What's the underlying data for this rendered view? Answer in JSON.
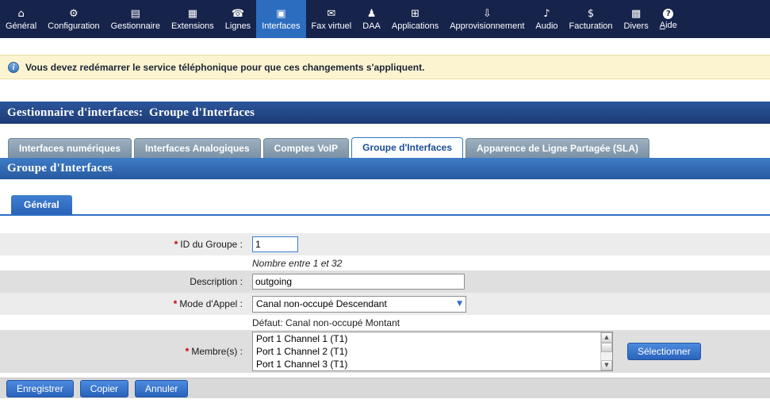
{
  "colors": {
    "accent": "#2d6fc4",
    "nav_bg": "#16234b",
    "nav_active_bg": "#2d6dbf",
    "banner_bg": "#fcf4d1",
    "header_bg": "#24498c",
    "required": "#cc0000"
  },
  "icons": {
    "general": "⌂",
    "configuration": "⚙",
    "gestionnaire": "▤",
    "extensions": "▦",
    "lignes": "☎",
    "interfaces": "▣",
    "fax": "✉",
    "daa": "♟",
    "applications": "⊞",
    "approvisionnement": "⇩",
    "audio": "♪",
    "facturation": "$",
    "divers": "▩",
    "aide": "?",
    "info": "i",
    "dropdown_arrow": "▼",
    "scroll_up": "▲",
    "scroll_down": "▼"
  },
  "nav": {
    "items": [
      {
        "label": "Général"
      },
      {
        "label": "Configuration"
      },
      {
        "label": "Gestionnaire"
      },
      {
        "label": "Extensions"
      },
      {
        "label": "Lignes"
      },
      {
        "label": "Interfaces"
      },
      {
        "label": "Fax virtuel"
      },
      {
        "label": "DAA"
      },
      {
        "label": "Applications"
      },
      {
        "label": "Approvisionnement"
      },
      {
        "label": "Audio"
      },
      {
        "label": "Facturation"
      },
      {
        "label": "Divers"
      },
      {
        "label": "Aide"
      }
    ]
  },
  "banner": {
    "text": "Vous devez redémarrer le service téléphonique pour que ces changements s'appliquent."
  },
  "page_header": {
    "title": "Gestionnaire d'interfaces:  Groupe d'Interfaces"
  },
  "tabs": [
    {
      "label": "Interfaces numériques"
    },
    {
      "label": "Interfaces Analogiques"
    },
    {
      "label": "Comptes VoIP"
    },
    {
      "label": "Groupe d'Interfaces"
    },
    {
      "label": "Apparence de Ligne Partagée (SLA)"
    }
  ],
  "section_header": {
    "title": "Groupe d'Interfaces"
  },
  "subtabs": [
    {
      "label": "Général"
    }
  ],
  "form": {
    "required_marker": "*",
    "group_id": {
      "label": "ID du Groupe :",
      "value": "1",
      "help": "Nombre entre 1 et 32"
    },
    "description": {
      "label": "Description :",
      "value": "outgoing"
    },
    "call_mode": {
      "label": "Mode d'Appel :",
      "value": "Canal non-occupé Descendant",
      "help": "Défaut: Canal non-occupé Montant"
    },
    "members": {
      "label": "Membre(s) :",
      "options": [
        "Port 1 Channel 1 (T1)",
        "Port 1 Channel 2 (T1)",
        "Port 1 Channel 3 (T1)"
      ],
      "button": "Sélectionner"
    }
  },
  "actions": {
    "save": "Enregistrer",
    "copy": "Copier",
    "cancel": "Annuler"
  }
}
